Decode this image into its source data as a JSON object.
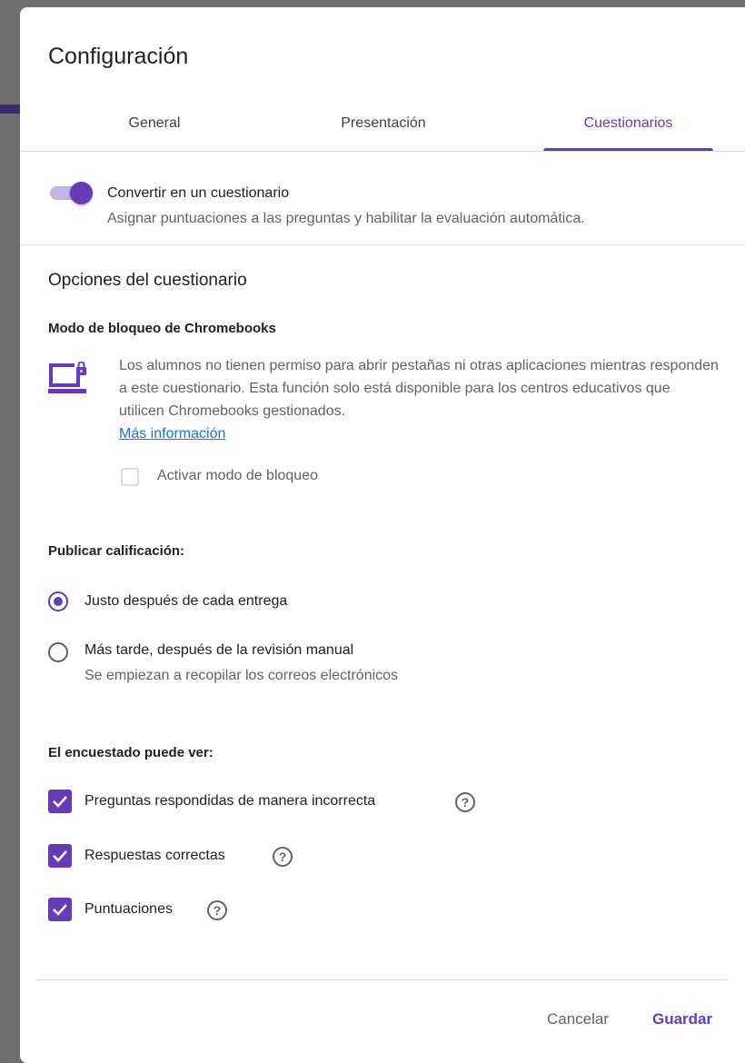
{
  "dialog": {
    "title": "Configuración"
  },
  "tabs": [
    {
      "label": "General",
      "active": false
    },
    {
      "label": "Presentación",
      "active": false
    },
    {
      "label": "Cuestionarios",
      "active": true
    }
  ],
  "quiz_toggle": {
    "label": "Convertir en un cuestionario",
    "description": "Asignar puntuaciones a las preguntas y habilitar la evaluación automática.",
    "enabled": true
  },
  "quiz_options": {
    "title": "Opciones del cuestionario",
    "lock_mode": {
      "heading": "Modo de bloqueo de Chromebooks",
      "description": "Los alumnos no tienen permiso para abrir pestañas ni otras aplicaciones mientras responden a este cuestionario. Esta función solo está disponible para los centros educativos que utilicen Chromebooks gestionados.",
      "link": "Más información",
      "checkbox_label": "Activar modo de bloqueo",
      "checked": false
    },
    "publish_grade": {
      "heading": "Publicar calificación:",
      "options": [
        {
          "label": "Justo después de cada entrega",
          "selected": true
        },
        {
          "label": "Más tarde, después de la revisión manual",
          "sub": "Se empiezan a recopilar los correos electrónicos",
          "selected": false
        }
      ]
    },
    "respondent_can_see": {
      "heading": "El encuestado puede ver:",
      "items": [
        {
          "label": "Preguntas respondidas de manera incorrecta",
          "checked": true
        },
        {
          "label": "Respuestas correctas",
          "checked": true
        },
        {
          "label": "Puntuaciones",
          "checked": true
        }
      ]
    }
  },
  "footer": {
    "cancel": "Cancelar",
    "save": "Guardar"
  },
  "colors": {
    "accent": "#673ab7",
    "link": "#1a73e8"
  }
}
